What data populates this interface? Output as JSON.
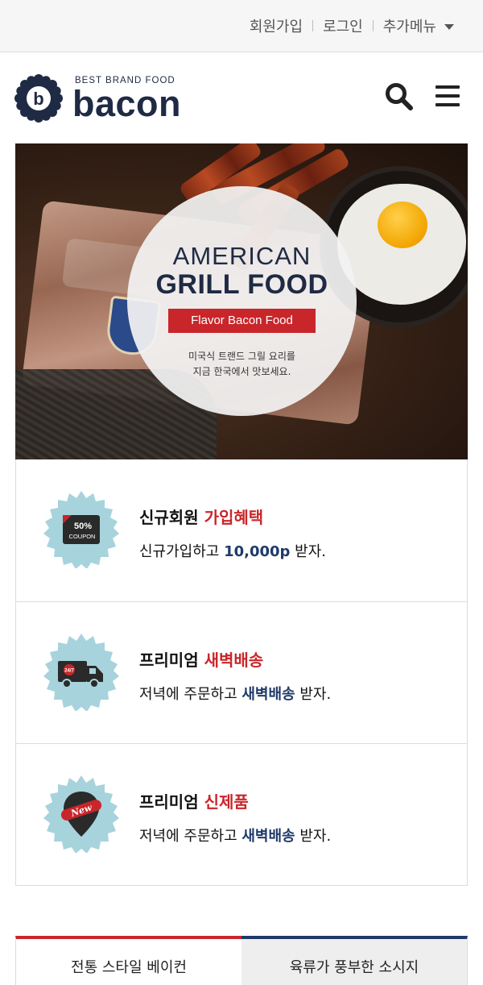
{
  "topbar": {
    "links": [
      {
        "label": "회원가입"
      },
      {
        "label": "로그인"
      },
      {
        "label": "추가메뉴"
      }
    ]
  },
  "header": {
    "logo_tagline": "BEST BRAND FOOD",
    "logo_word": "bacon",
    "logo_letter": "b",
    "search_icon": "search-icon",
    "menu_icon": "hamburger-menu-icon"
  },
  "hero": {
    "title_line1": "AMERICAN",
    "title_line2": "GRILL FOOD",
    "tag": "Flavor Bacon Food",
    "desc_line1": "미국식 트랜드 그릴 요리를",
    "desc_line2": "지금 한국에서 맛보세요."
  },
  "features": [
    {
      "icon": "coupon-icon",
      "badge_text_1": "50%",
      "badge_text_2": "COUPON",
      "title_plain": "신규회원 ",
      "title_highlight": "가입혜택",
      "desc_before": "신규가입하고 ",
      "desc_highlight": "10,000p",
      "desc_after": " 받자."
    },
    {
      "icon": "delivery-truck-icon",
      "badge_text_1": "24/7",
      "title_plain": "프리미엄 ",
      "title_highlight": "새벽배송",
      "desc_before": "저녁에 주문하고 ",
      "desc_highlight": "새벽배송",
      "desc_after": " 받자."
    },
    {
      "icon": "new-location-pin-icon",
      "badge_text_1": "New",
      "title_plain": "프리미엄 ",
      "title_highlight": "신제품",
      "desc_before": "저녁에 주문하고 ",
      "desc_highlight": "새벽배송",
      "desc_after": " 받자."
    }
  ],
  "tabs": [
    {
      "label": "전통 스타일 베이컨",
      "active": true
    },
    {
      "label": "육류가 풍부한 소시지",
      "active": false
    }
  ],
  "colors": {
    "brand_navy": "#1f2a44",
    "accent_red": "#c8262a",
    "badge_teal": "#a7d3dc"
  }
}
